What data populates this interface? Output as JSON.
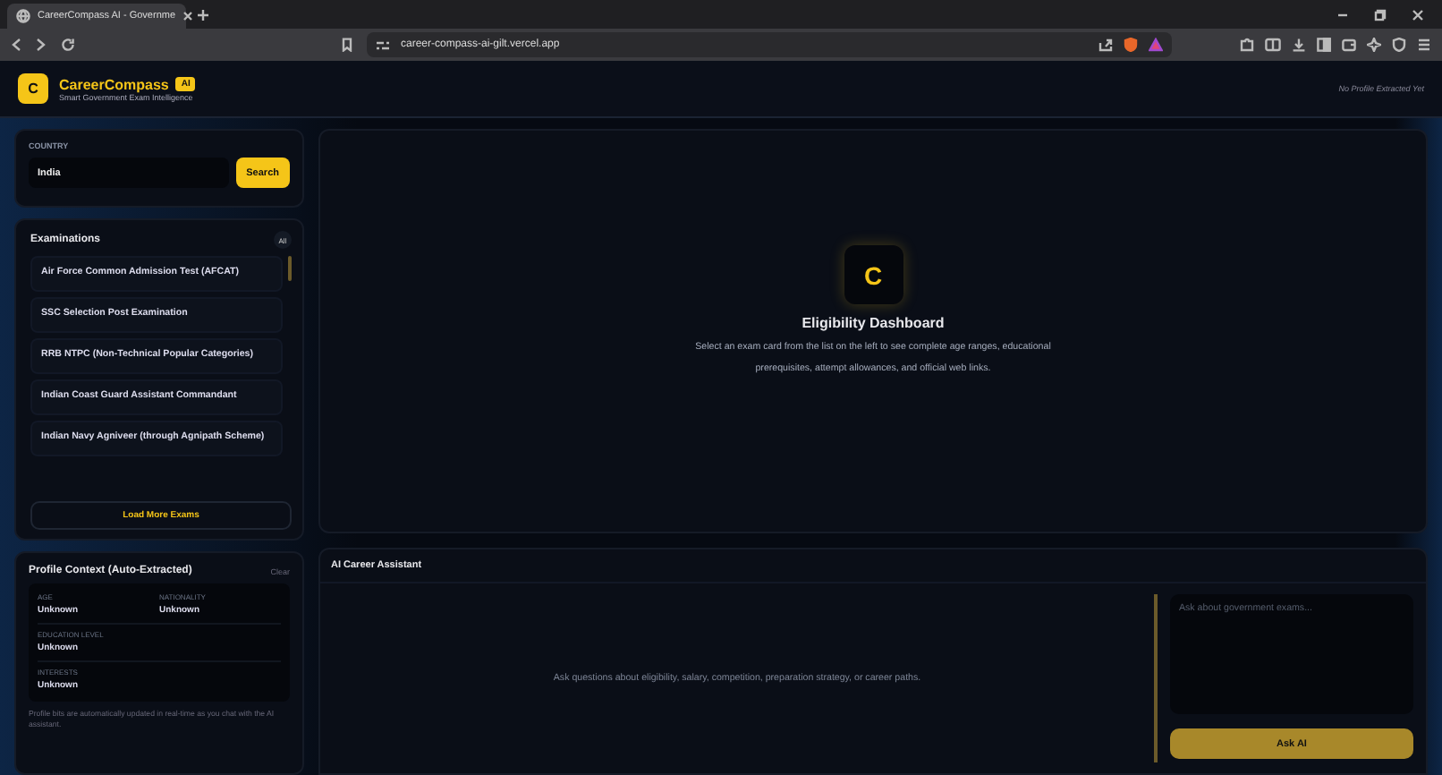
{
  "browser": {
    "tab_title": "CareerCompass AI - Governme",
    "url": "career-compass-ai-gilt.vercel.app"
  },
  "header": {
    "logo_letter": "C",
    "title": "CareerCompass",
    "badge": "AI",
    "subtitle": "Smart Government Exam Intelligence",
    "profile_status": "No Profile Extracted Yet"
  },
  "country": {
    "label": "COUNTRY",
    "value": "India",
    "button": "Search"
  },
  "exams": {
    "title": "Examinations",
    "badge": "All",
    "items": [
      {
        "label": "Air Force Common Admission Test (AFCAT)"
      },
      {
        "label": "SSC Selection Post Examination"
      },
      {
        "label": "RRB NTPC (Non-Technical Popular Categories)"
      },
      {
        "label": "Indian Coast Guard Assistant Commandant"
      },
      {
        "label": "Indian Navy Agniveer (through Agnipath Scheme)"
      }
    ],
    "load_more": "Load More Exams"
  },
  "profile": {
    "title": "Profile Context (Auto-Extracted)",
    "clear": "Clear",
    "fields": [
      {
        "label": "AGE",
        "value": "Unknown"
      },
      {
        "label": "NATIONALITY",
        "value": "Unknown"
      },
      {
        "label": "EDUCATION LEVEL",
        "value": "Unknown"
      },
      {
        "label": "INTERESTS",
        "value": "Unknown"
      }
    ],
    "note": "Profile bits are automatically updated in real-time as you chat with the AI assistant."
  },
  "dashboard": {
    "logo_letter": "C",
    "title": "Eligibility Dashboard",
    "description": "Select an exam card from the list on the left to see complete age ranges, educational prerequisites, attempt allowances, and official web links."
  },
  "assistant": {
    "title": "AI Career Assistant",
    "empty_text": "Ask questions about eligibility, salary, competition, preparation strategy, or career paths.",
    "placeholder": "Ask about government exams...",
    "button": "Ask AI"
  }
}
